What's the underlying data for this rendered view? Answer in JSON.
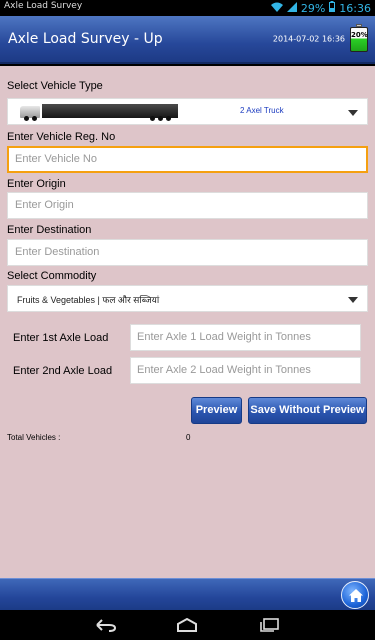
{
  "status_bar": {
    "app_label": "Axle Load Survey",
    "battery_percent": "29%",
    "time": "16:36"
  },
  "header": {
    "title": "Axle Load Survey - Up",
    "datetime": "2014-07-02 16:36",
    "battery_text": "20%"
  },
  "form": {
    "vehicle_type_label": "Select Vehicle Type",
    "vehicle_type_value": "2 Axel Truck",
    "reg_label": "Enter Vehicle Reg. No",
    "reg_placeholder": "Enter Vehicle No",
    "origin_label": "Enter Origin",
    "origin_placeholder": "Enter Origin",
    "destination_label": "Enter Destination",
    "destination_placeholder": "Enter Destination",
    "commodity_label": "Select Commodity",
    "commodity_value": "Fruits & Vegetables | फल और सब्जियां",
    "axle1_label": "Enter 1st Axle Load",
    "axle1_placeholder": "Enter Axle 1 Load Weight in Tonnes",
    "axle2_label": "Enter 2nd Axle Load",
    "axle2_placeholder": "Enter Axle 2 Load Weight in Tonnes"
  },
  "buttons": {
    "preview": "Preview",
    "save_without_preview": "Save Without Preview"
  },
  "summary": {
    "total_vehicles_label": "Total Vehicles :",
    "total_vehicles_value": "0"
  },
  "icons": {
    "wifi": "wifi-icon",
    "signal": "signal-icon",
    "battery": "battery-icon",
    "home": "home-icon",
    "back": "back-icon",
    "nav_home": "nav-home-icon",
    "recents": "recents-icon"
  },
  "colors": {
    "header": "#27489a",
    "background": "#dec5c9",
    "focus": "#f5a010",
    "accent": "#33b5e5"
  }
}
